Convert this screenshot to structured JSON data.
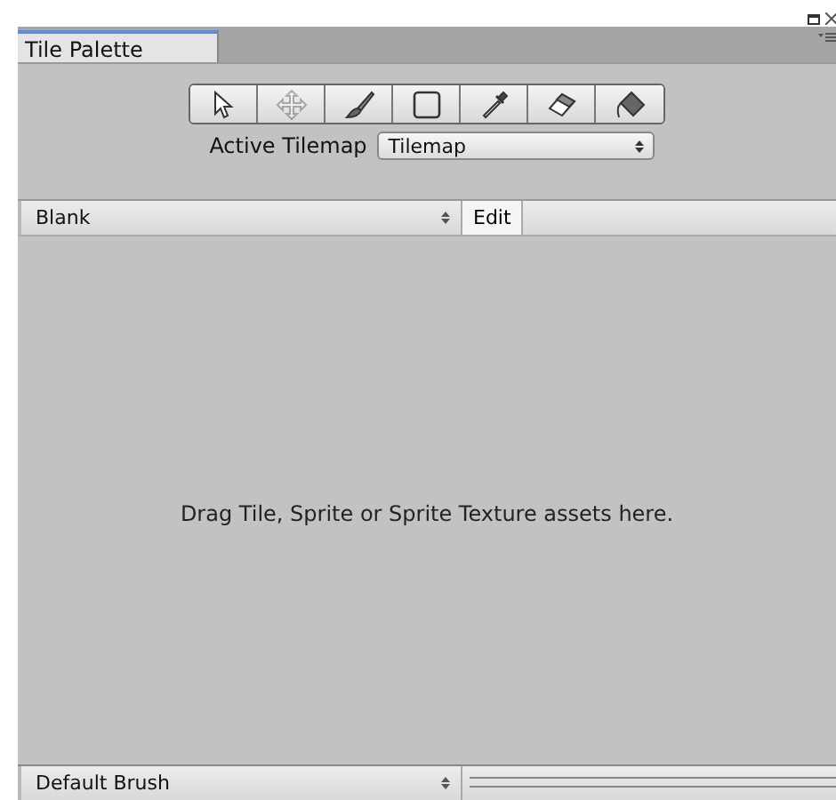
{
  "window": {
    "title": "Tile Palette"
  },
  "tools": [
    {
      "kind": "select",
      "selected": false,
      "disabled": false
    },
    {
      "kind": "move",
      "selected": false,
      "disabled": true
    },
    {
      "kind": "paint",
      "selected": false,
      "disabled": false
    },
    {
      "kind": "box",
      "selected": false,
      "disabled": false
    },
    {
      "kind": "picker",
      "selected": false,
      "disabled": false
    },
    {
      "kind": "erase",
      "selected": false,
      "disabled": false
    },
    {
      "kind": "fill",
      "selected": false,
      "disabled": false
    }
  ],
  "active_tilemap": {
    "label": "Active Tilemap",
    "value": "Tilemap"
  },
  "palette": {
    "value": "Blank",
    "edit_button": "Edit"
  },
  "empty_message": "Drag Tile, Sprite or Sprite Texture assets here.",
  "brush": {
    "value": "Default Brush"
  }
}
